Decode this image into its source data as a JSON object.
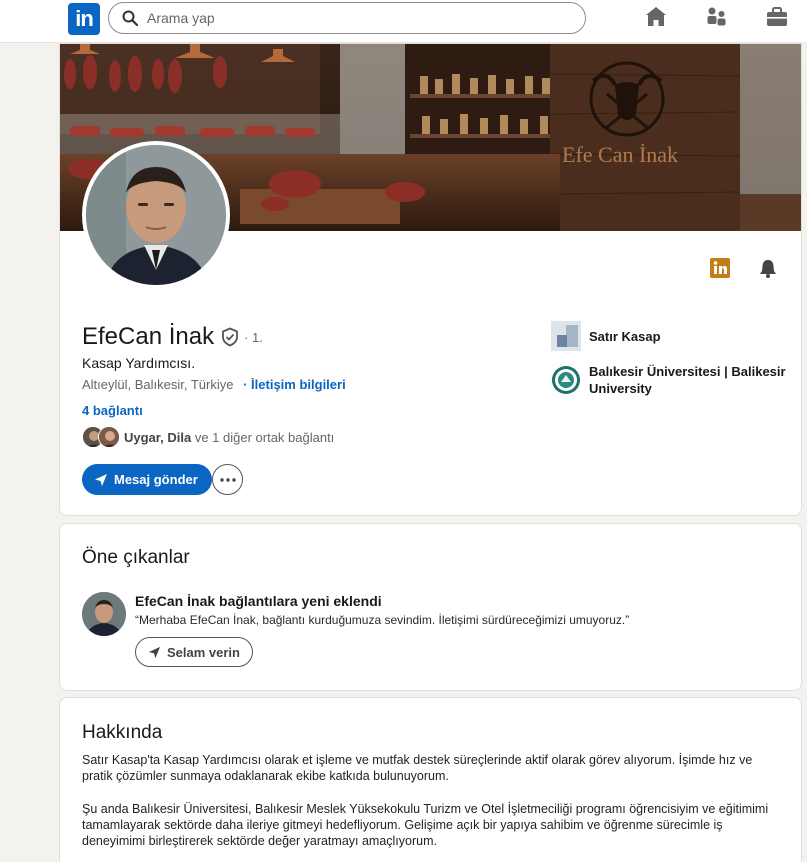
{
  "nav": {
    "logo_text": "in",
    "search_placeholder": "Arama yap",
    "icons": [
      "home-icon",
      "people-icon",
      "briefcase-icon"
    ]
  },
  "profile": {
    "name": "EfeCan İnak",
    "degree": "· 1.",
    "headline": "Kasap Yardımcısı.",
    "location": "Altıeylül, Balıkesir, Türkiye",
    "contact_link": "· İletişim bilgileri",
    "connections": "4 bağlantı",
    "mutual_names": "Uygar, Dila",
    "mutual_rest": " ve 1 diğer ortak bağlantı",
    "message_button": "Mesaj gönder",
    "banner_brand": "Efe Can İnak",
    "experience": [
      {
        "label": "Satır Kasap"
      },
      {
        "label": "Balıkesir Üniversitesi | Balikesir University"
      }
    ]
  },
  "highlights": {
    "title": "Öne çıkanlar",
    "item_title": "EfeCan İnak bağlantılara yeni eklendi",
    "item_quote": "“Merhaba EfeCan İnak, bağlantı kurduğumuza sevindim. İletişimi sürdüreceğimizi umuyoruz.”",
    "button": "Selam verin"
  },
  "about": {
    "title": "Hakkında",
    "p1": "Satır Kasap'ta Kasap Yardımcısı olarak et işleme ve mutfak destek süreçlerinde aktif olarak görev alıyorum. İşimde hız ve pratik çözümler sunmaya odaklanarak ekibe katkıda bulunuyorum.",
    "p2": "Şu anda Balıkesir Üniversitesi, Balıkesir Meslek Yüksekokulu Turizm ve Otel İşletmeciliği programı öğrencisiyim ve eğitimimi tamamlayarak sektörde daha ileriye gitmeyi hedefliyorum. Gelişime açık bir yapıya sahibim ve öğrenme sürecimle iş deneyimimi birleştirerek sektörde değer yaratmayı amaçlıyorum."
  },
  "colors": {
    "brand": "#0a66c2",
    "background": "#f4f2ee",
    "linkedin_badge": "#c37d16"
  }
}
